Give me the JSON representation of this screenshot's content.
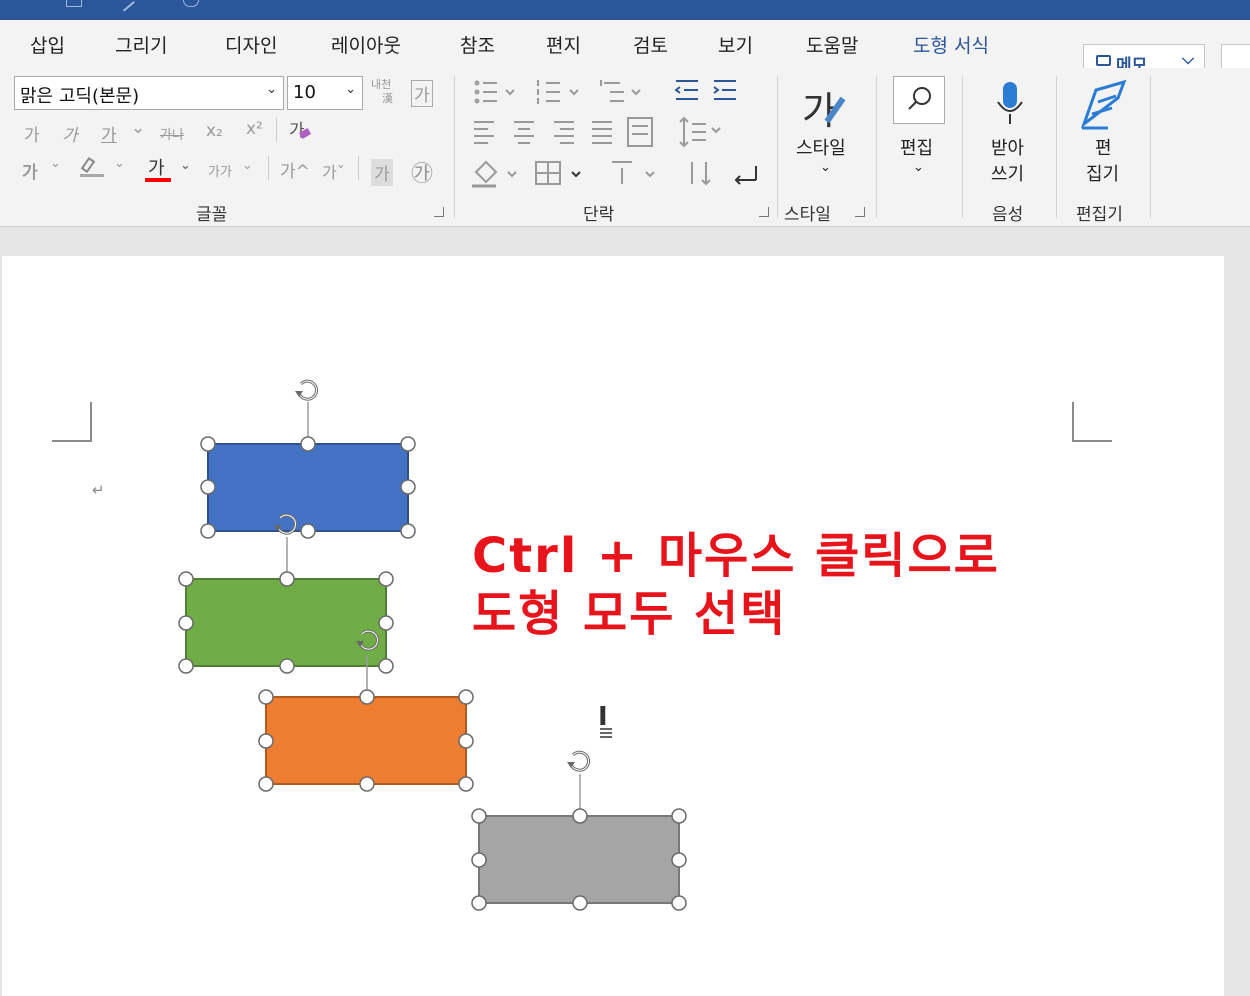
{
  "colors": {
    "titlebar": "#2b579a",
    "accent_tab": "#2b579a",
    "shape_blue": "#4472c4",
    "shape_green": "#70ad47",
    "shape_orange": "#ed7d31",
    "shape_gray": "#a5a5a5",
    "annotation_red": "#e8141c",
    "font_color_bar": "#ff0000"
  },
  "tabs": [
    {
      "label": "삽입"
    },
    {
      "label": "그리기"
    },
    {
      "label": "디자인"
    },
    {
      "label": "레이아웃"
    },
    {
      "label": "참조"
    },
    {
      "label": "편지"
    },
    {
      "label": "검토"
    },
    {
      "label": "보기"
    },
    {
      "label": "도움말"
    },
    {
      "label": "도형 서식",
      "active_context": true
    }
  ],
  "memo_button": {
    "label": "메모",
    "icon": "comment-icon",
    "chevron": "⌵"
  },
  "font_group": {
    "label": "글꼴",
    "font_name": "맑은 고딕(본문)",
    "font_size": "10",
    "dropdown_glyph": "⌄",
    "hanja_label": "내천",
    "hanja_sub": "漢",
    "clear_fmt": "가",
    "bold": "가",
    "italic": "가",
    "underline": "가",
    "strike": "가나",
    "subscript": "x₂",
    "superscript": "x²",
    "phonetic": "가",
    "text_effect": "가",
    "font_color_glyph": "가",
    "char_size": "가가",
    "grow": "가^",
    "shrink": "가ˇ",
    "char_shading": "가",
    "enclose": "㉮"
  },
  "paragraph_group": {
    "label": "단락"
  },
  "styles_group": {
    "label": "스타일",
    "button": "스타일",
    "glyph": "가"
  },
  "editing_group": {
    "button": "편집",
    "icon": "search-icon"
  },
  "voice_group": {
    "label": "음성",
    "button_line1": "받아",
    "button_line2": "쓰기",
    "icon": "microphone-icon"
  },
  "editor_group": {
    "label": "편집기",
    "button_line1": "편",
    "button_line2": "집기",
    "icon": "editor-pen-icon"
  },
  "document": {
    "paragraph_mark": "↵",
    "annotation_line1": "Ctrl + 마우스 클릭으로",
    "annotation_line2": "도형 모두 선택",
    "cursor_glyph": "I",
    "shapes": [
      {
        "name": "blue",
        "color": "#4472c4"
      },
      {
        "name": "green",
        "color": "#70ad47"
      },
      {
        "name": "orange",
        "color": "#ed7d31"
      },
      {
        "name": "gray",
        "color": "#a5a5a5"
      }
    ]
  }
}
